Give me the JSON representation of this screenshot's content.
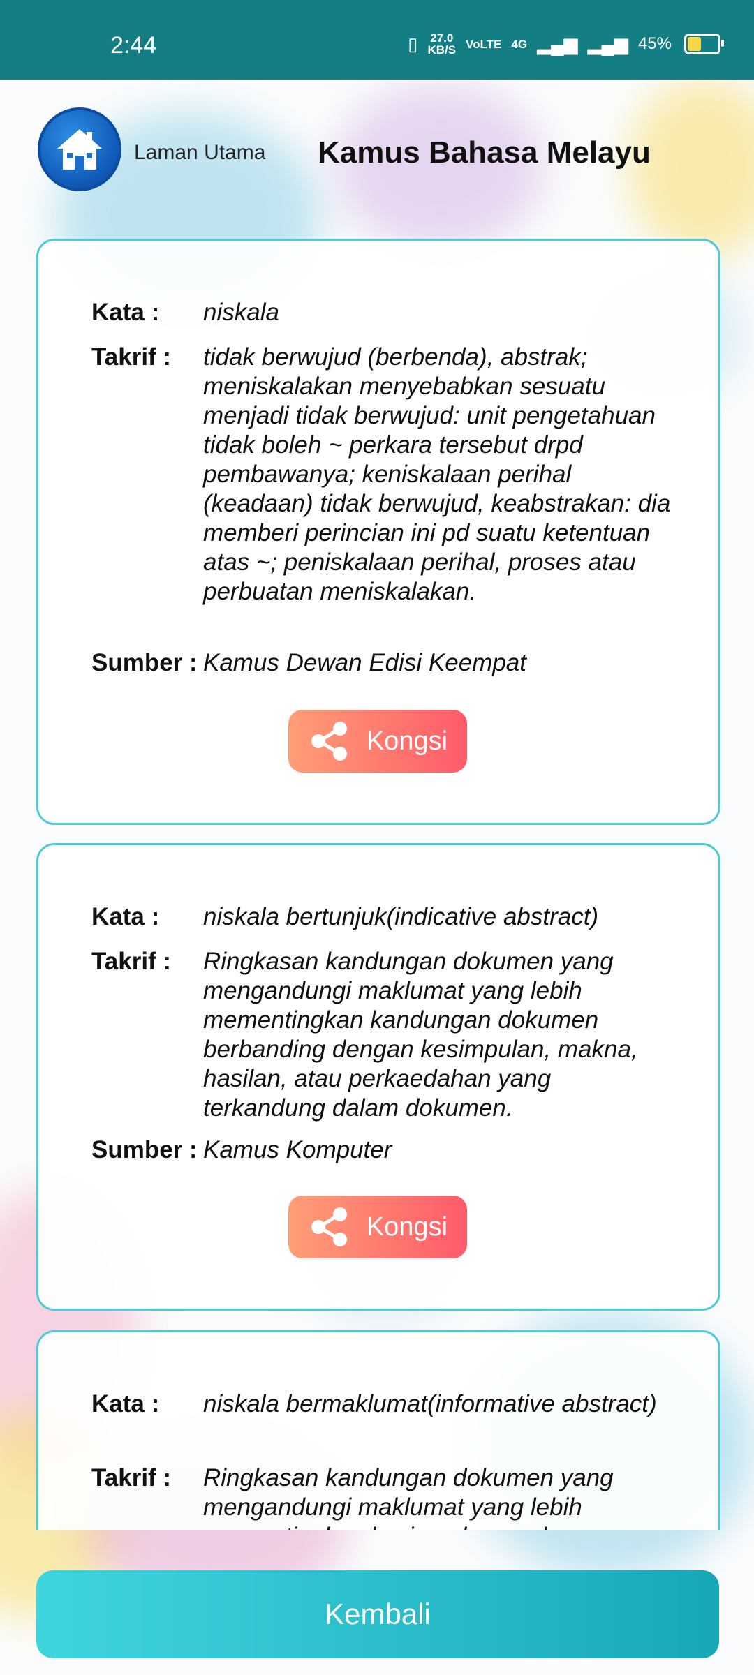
{
  "status_bar": {
    "time": "2:44",
    "net_speed": "27.0",
    "net_unit": "KB/S",
    "volte": "VoLTE",
    "network": "4G",
    "battery_percent": "45%",
    "battery_level": 0.45
  },
  "header": {
    "home_label": "Laman Utama",
    "title": "Kamus Bahasa Melayu"
  },
  "labels": {
    "kata": "Kata :",
    "takrif": "Takrif :",
    "sumber": "Sumber :",
    "share": "Kongsi"
  },
  "entries": [
    {
      "kata": "niskala",
      "takrif": "tidak berwujud (berbenda), abstrak; meniskalakan menyebabkan sesuatu menjadi tidak berwujud: unit pengetahuan tidak boleh ~ perkara tersebut drpd pembawanya; keniskalaan perihal (keadaan) tidak berwujud, keabstrakan: dia memberi perincian ini pd suatu ketentuan atas ~; peniskalaan perihal, proses atau perbuatan meniskalakan.",
      "sumber": "Kamus Dewan Edisi Keempat"
    },
    {
      "kata": "niskala bertunjuk(indicative abstract)",
      "takrif": "Ringkasan kandungan dokumen yang mengandungi maklumat yang lebih mementingkan kandungan dokumen berbanding dengan kesimpulan, makna, hasilan, atau perkaedahan yang terkandung dalam dokumen.",
      "sumber": "Kamus Komputer"
    },
    {
      "kata": "niskala bermaklumat(informative abstract)",
      "takrif": "Ringkasan kandungan dokumen yang mengandungi maklumat yang lebih mementingkan kesimpulan, makna",
      "sumber": ""
    }
  ],
  "footer": {
    "back_label": "Kembali"
  },
  "colors": {
    "status_bar": "#137f84",
    "card_border": "#4dcbd6",
    "share_gradient": [
      "#ff9e76",
      "#ff5b6a"
    ],
    "back_gradient": [
      "#3fd5de",
      "#16a8b7"
    ]
  }
}
